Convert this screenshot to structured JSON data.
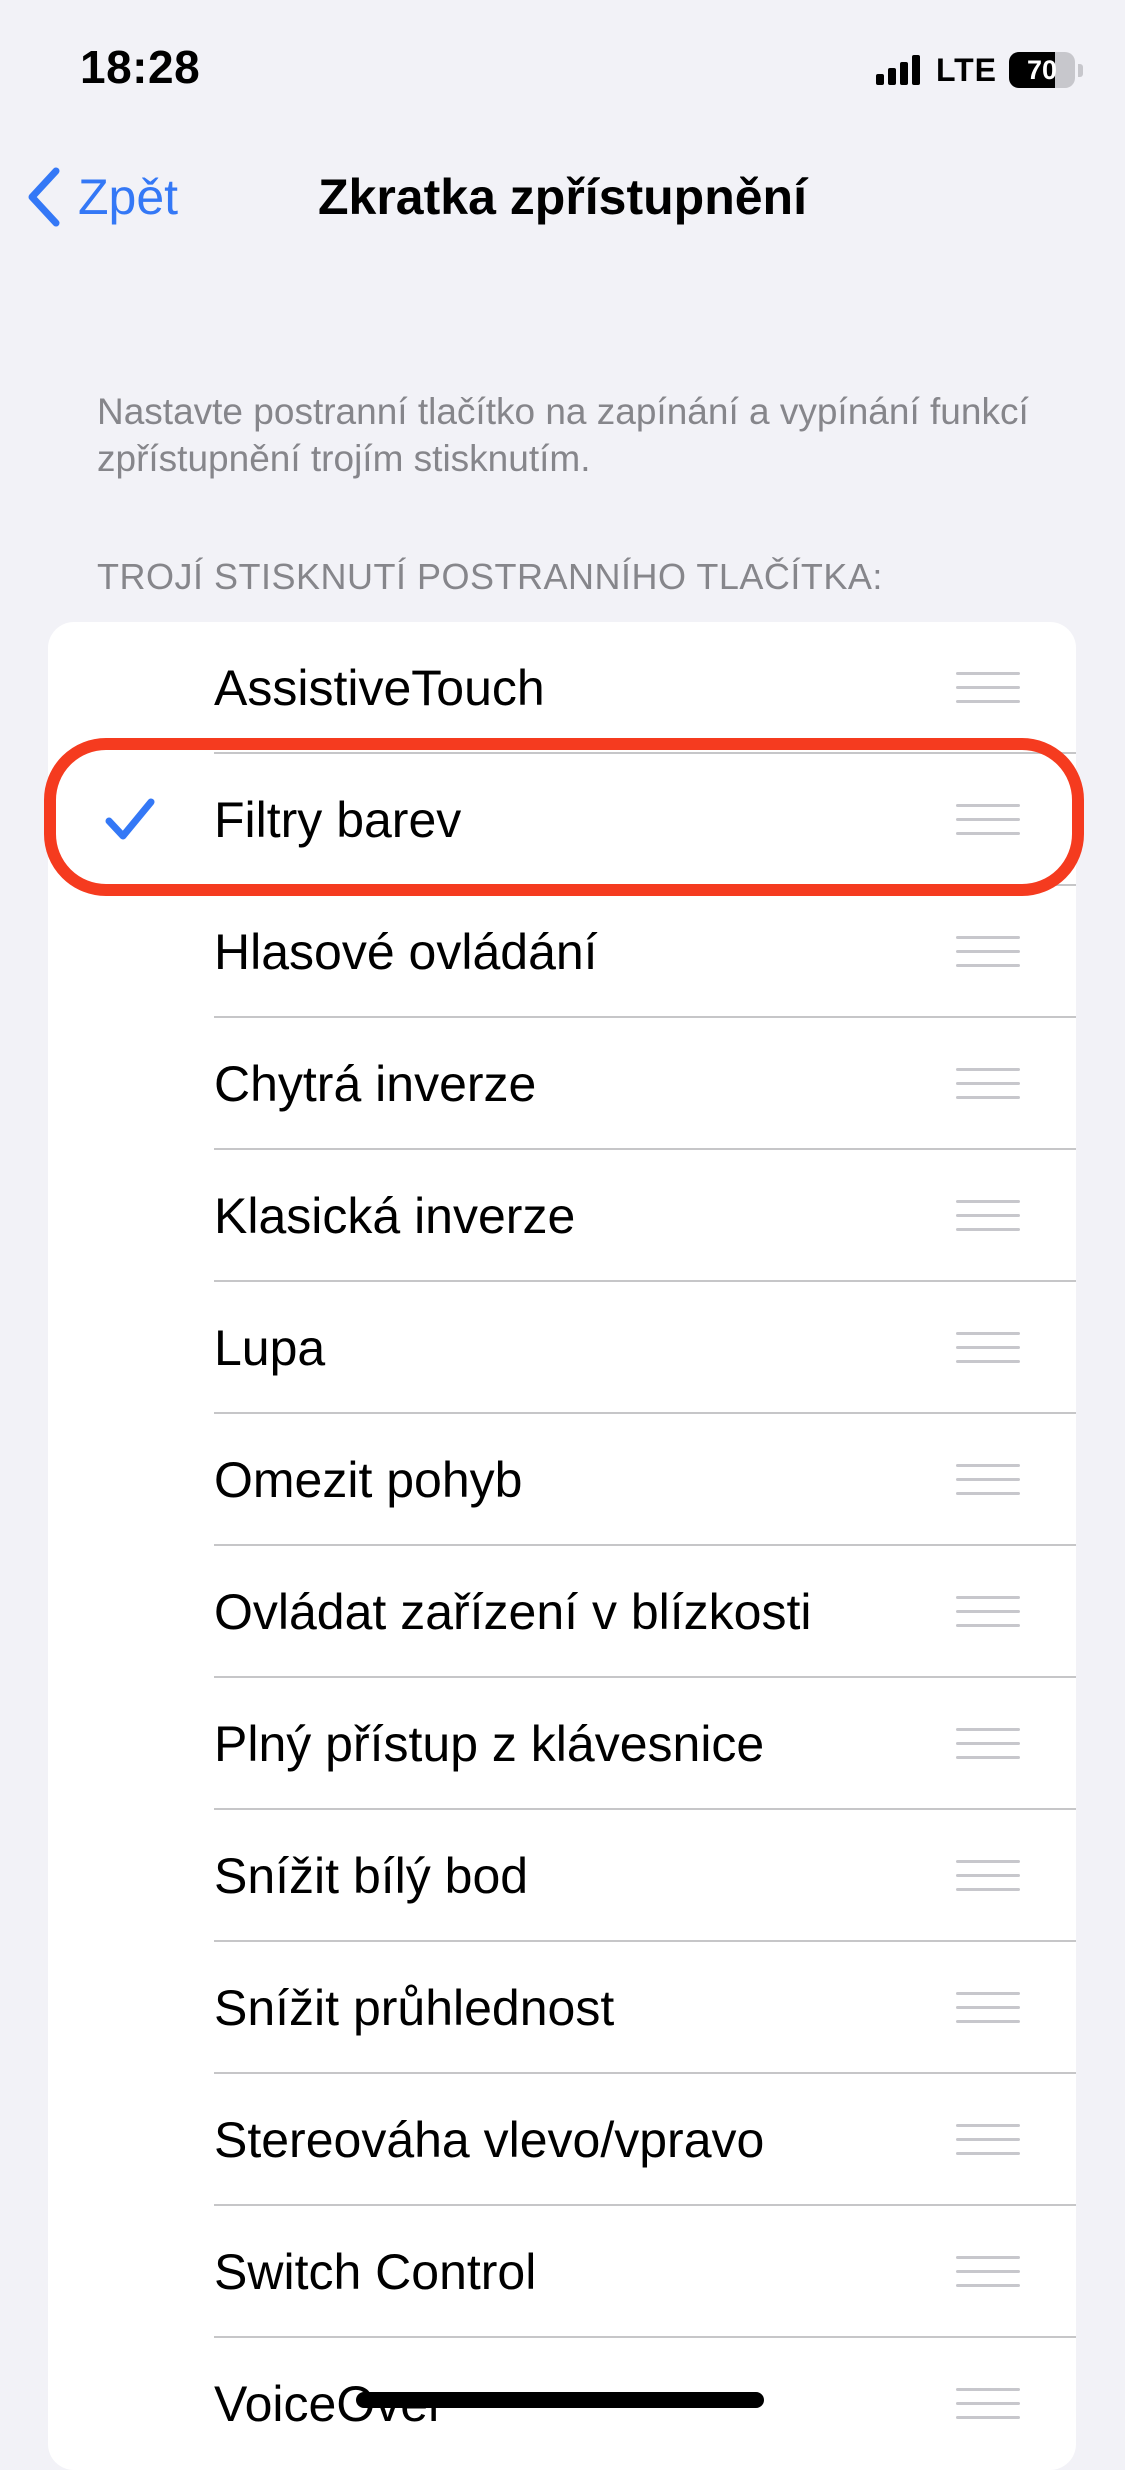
{
  "status_bar": {
    "time": "18:28",
    "network": "LTE",
    "signal_bars": 4,
    "battery_percent": "70",
    "battery_level": 0.7
  },
  "nav": {
    "back_label": "Zpět",
    "title": "Zkratka zpřístupnění",
    "back_icon": "chevron-left-icon"
  },
  "description": "Nastavte postranní tlačítko na zapínání a vypínání funkcí zpřístupnění trojím stisknutím.",
  "section_header": "TROJÍ STISKNUTÍ POSTRANNÍHO TLAČÍTKA:",
  "items": [
    {
      "label": "AssistiveTouch",
      "checked": false
    },
    {
      "label": "Filtry barev",
      "checked": true
    },
    {
      "label": "Hlasové ovládání",
      "checked": false
    },
    {
      "label": "Chytrá inverze",
      "checked": false
    },
    {
      "label": "Klasická inverze",
      "checked": false
    },
    {
      "label": "Lupa",
      "checked": false
    },
    {
      "label": "Omezit pohyb",
      "checked": false
    },
    {
      "label": "Ovládat zařízení v blízkosti",
      "checked": false
    },
    {
      "label": "Plný přístup z klávesnice",
      "checked": false
    },
    {
      "label": "Snížit bílý bod",
      "checked": false
    },
    {
      "label": "Snížit průhlednost",
      "checked": false
    },
    {
      "label": "Stereováha vlevo/vpravo",
      "checked": false
    },
    {
      "label": "Switch Control",
      "checked": false
    },
    {
      "label": "VoiceOver",
      "checked": false
    }
  ],
  "icons": {
    "check": "checkmark-icon",
    "reorder": "reorder-handle-icon"
  },
  "colors": {
    "accent": "#3478f6",
    "background": "#f2f2f7",
    "secondary_text": "#86868b",
    "annotation": "#f53b1f"
  }
}
